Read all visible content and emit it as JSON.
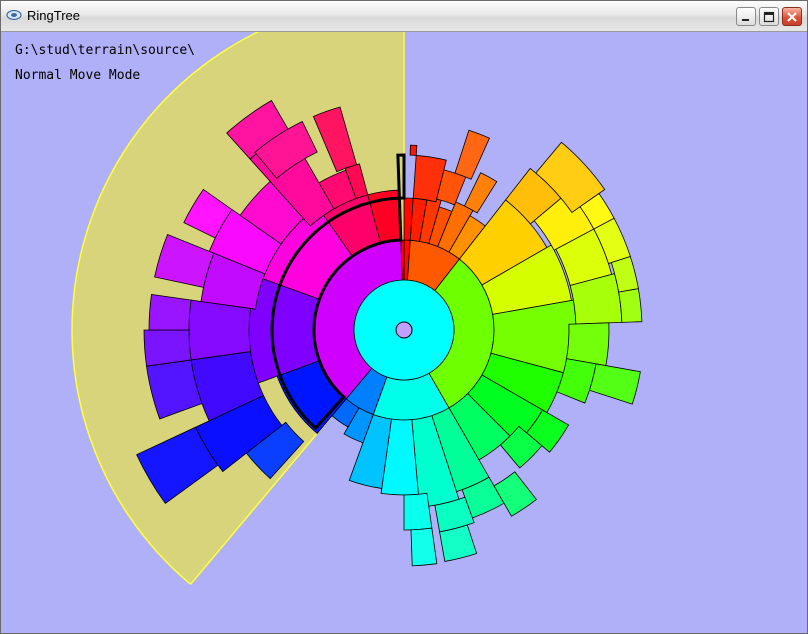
{
  "window": {
    "title": "RingTree",
    "minimize": "minimize",
    "maximize": "maximize",
    "close": "close"
  },
  "overlay": {
    "path": "G:\\stud\\terrain\\source\\",
    "mode": "Normal Move Mode"
  },
  "icons": {
    "app": "app-icon",
    "minimize": "minimize-icon",
    "maximize": "maximize-icon",
    "close": "close-icon"
  },
  "colors": {
    "background": "#b0b0f8",
    "selection": "#d8d47c",
    "selection_edge": "#ffff3c",
    "outline": "#000000"
  }
}
